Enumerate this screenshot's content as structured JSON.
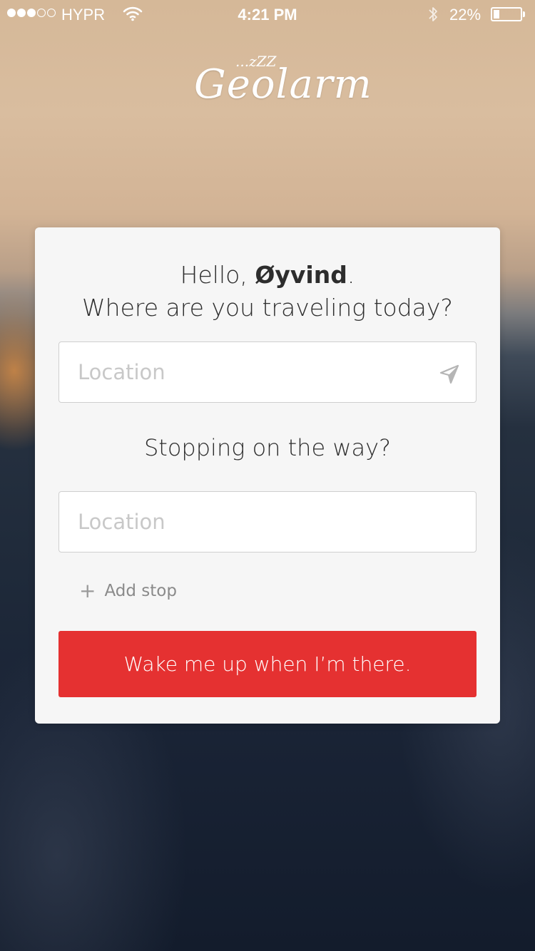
{
  "status_bar": {
    "signal_dots": 5,
    "signal_filled": 3,
    "carrier": "HYPR",
    "time": "4:21 PM",
    "battery_percent": "22%",
    "battery_level": 0.22,
    "icons": [
      "wifi-icon",
      "bluetooth-icon",
      "battery-icon"
    ]
  },
  "logo": {
    "text": "Geolarm",
    "zzz": "...zZZ"
  },
  "greeting": {
    "hello": "Hello,",
    "name": "Øyvind",
    "period": ".",
    "question": "Where are you traveling today?"
  },
  "destination": {
    "placeholder": "Location",
    "value": "",
    "icon": "location-arrow-icon"
  },
  "stopover": {
    "question": "Stopping on the way?",
    "placeholder": "Location",
    "value": ""
  },
  "add_stop": {
    "icon": "plus-icon",
    "label": "Add stop"
  },
  "cta": {
    "label": "Wake me up when I’m there."
  },
  "colors": {
    "accent": "#e53131",
    "card": "#f6f6f6",
    "text": "#2d2d2d",
    "placeholder": "#c8c8c8"
  }
}
